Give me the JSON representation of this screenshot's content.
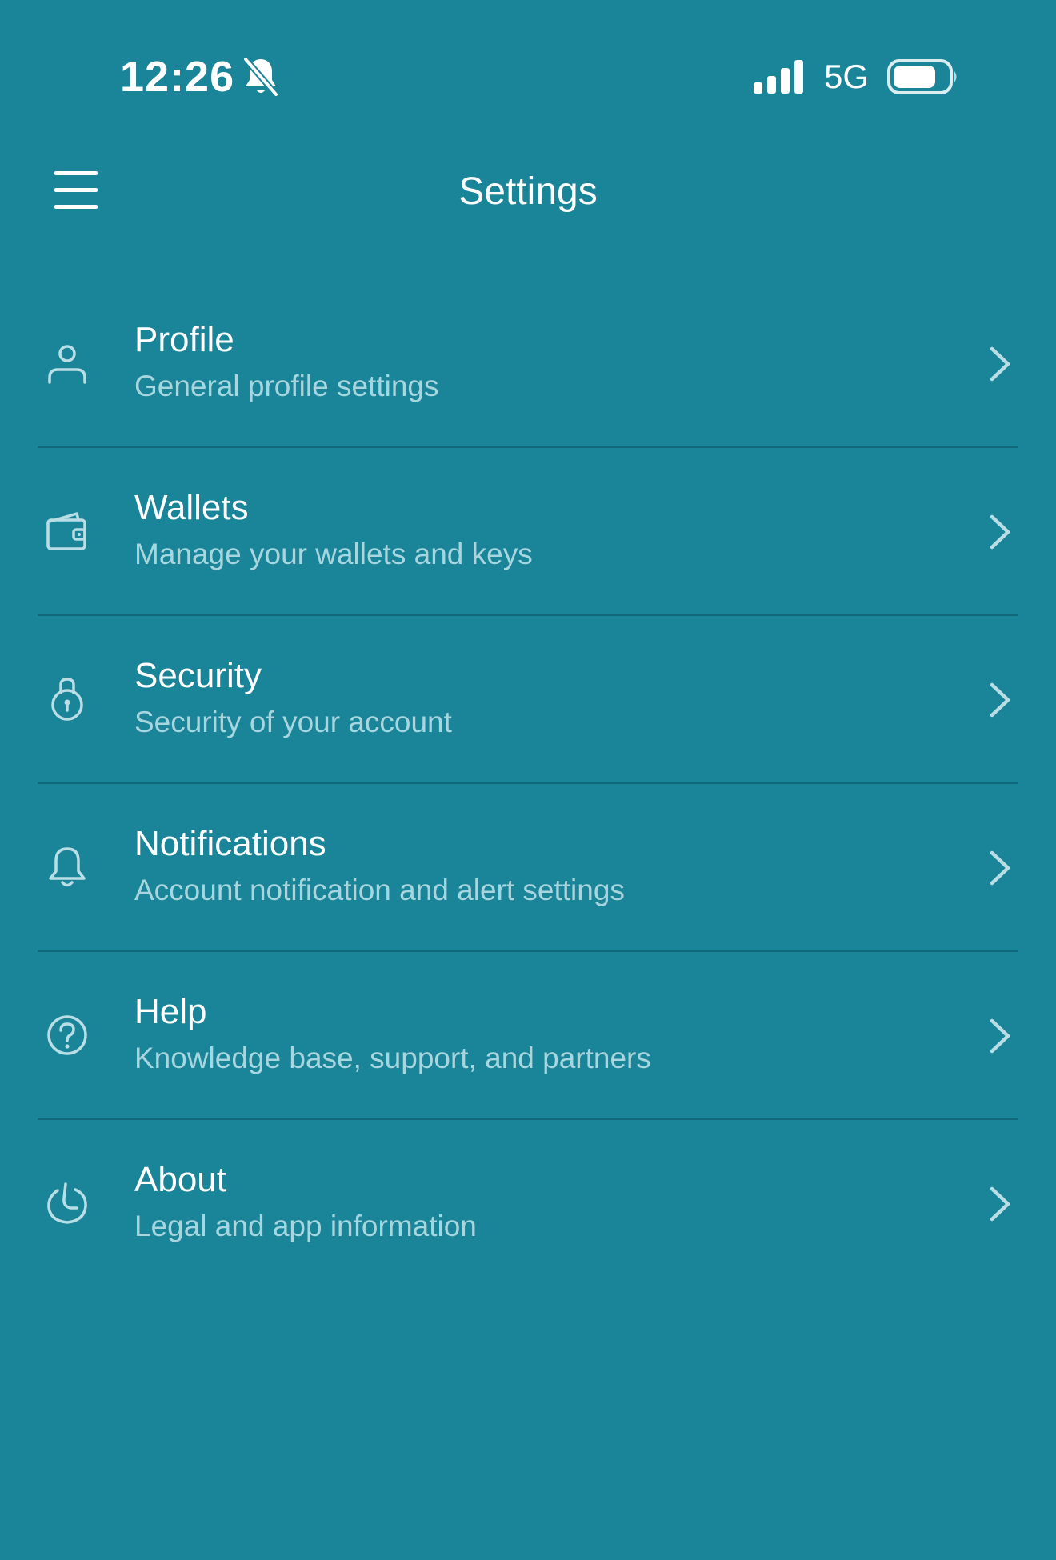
{
  "status_bar": {
    "time": "12:26",
    "network": "5G",
    "icons": [
      "bell-slash-icon",
      "cellular-signal-icon",
      "battery-icon"
    ]
  },
  "header": {
    "title": "Settings",
    "menu_icon": "hamburger-menu-icon"
  },
  "settings": [
    {
      "title": "Profile",
      "subtitle": "General profile settings",
      "icon": "user-icon"
    },
    {
      "title": "Wallets",
      "subtitle": "Manage your wallets and keys",
      "icon": "wallet-icon"
    },
    {
      "title": "Security",
      "subtitle": "Security of your account",
      "icon": "lock-icon"
    },
    {
      "title": "Notifications",
      "subtitle": "Account notification and alert settings",
      "icon": "bell-icon"
    },
    {
      "title": "Help",
      "subtitle": "Knowledge base, support, and partners",
      "icon": "question-circle-icon"
    },
    {
      "title": "About",
      "subtitle": "Legal and app information",
      "icon": "app-logo-icon"
    }
  ],
  "colors": {
    "background": "#1A8499",
    "divider": "#12677A",
    "text": "#FFFFFF",
    "subtext": "#A8D6DF",
    "icon": "#B9DEE6"
  }
}
